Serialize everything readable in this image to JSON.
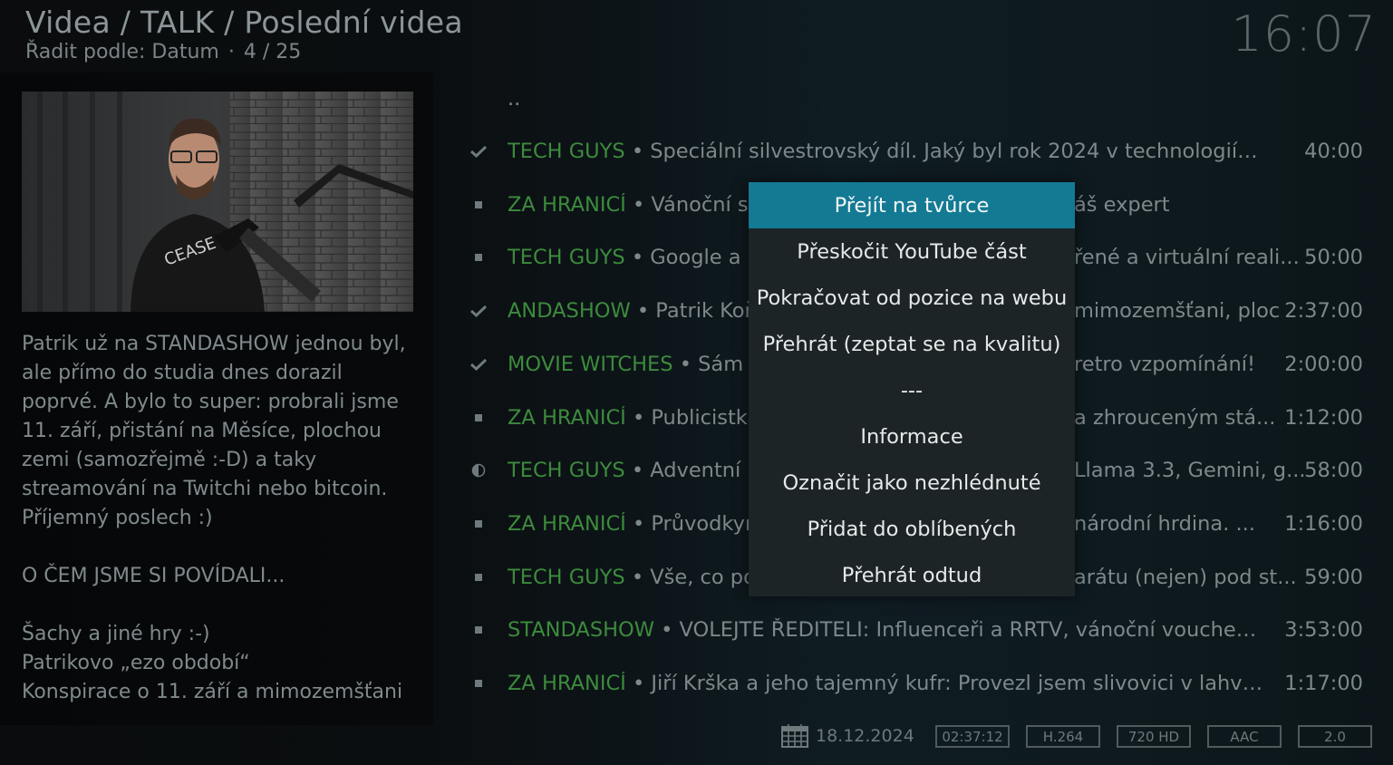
{
  "header": {
    "title": "Videa / TALK / Poslední videa",
    "sort_label": "Řadit podle: Datum",
    "position": "4 / 25"
  },
  "clock": "16:07",
  "description": "Patrik už na STANDASHOW jednou byl, ale přímo do studia dnes dorazil poprvé. A bylo to super: probrali jsme 11. září, přistání na Měsíce, plochou zemi (samozřejmě :-D) a taky streamování na Twitchi nebo bitcoin. Příjemný poslech :)\n\nO ČEM JSME SI POVÍDALI...\n\nŠachy a jiné hry :-)\nPatrikovo „ezo období“\nKonspirace o 11. září a mimozemšťani",
  "list": {
    "parent": "..",
    "items": [
      {
        "status": "watched",
        "channel": "TECH GUYS",
        "title": " • Speciální silvestrovský díl. Jaký byl rok 2024 v technologiích a c...",
        "duration": "40:00"
      },
      {
        "status": "unwatched",
        "channel": "ZA HRANICÍ",
        "title": " • Vánoční sp",
        "tail": "áš expert",
        "duration": ""
      },
      {
        "status": "unwatched",
        "channel": "TECH GUYS",
        "title": " • Google a S",
        "tail": "řené a virtuální reali...",
        "duration": "50:00"
      },
      {
        "status": "watched",
        "channel": "ANDASHOW",
        "title": " • Patrik Koř",
        "tail": "mimozemšťani, ploc",
        "duration": "2:37:00"
      },
      {
        "status": "watched",
        "channel": "MOVIE WITCHES",
        "title": " • Sám d",
        "tail": "retro vzpomínání!",
        "duration": "2:00:00"
      },
      {
        "status": "unwatched",
        "channel": "ZA HRANICÍ",
        "title": " • Publicistka",
        "tail": "a zhrouceným stá...",
        "duration": "1:12:00"
      },
      {
        "status": "partial",
        "channel": "TECH GUYS",
        "title": " • Adventní k",
        "tail": "Llama 3.3, Gemini, g...",
        "duration": "58:00"
      },
      {
        "status": "unwatched",
        "channel": "ZA HRANICÍ",
        "title": " • Průvodkyn",
        "tail": "národní hrdina. ...",
        "duration": "1:16:00"
      },
      {
        "status": "unwatched",
        "channel": "TECH GUYS",
        "title": " • Vše, co pot",
        "tail": "arátu (nejen) pod st...",
        "duration": "59:00"
      },
      {
        "status": "unwatched",
        "channel": "STANDASHOW",
        "title": " • VOLEJTE ŘEDITELI: Influenceři a RRTV, vánoční vouchery, s...",
        "duration": "3:53:00"
      },
      {
        "status": "unwatched",
        "channel": "ZA HRANICÍ",
        "title": " • Jiří Krška a jeho tajemný kufr: Provezl jsem slivovici v lahvích ...",
        "duration": "1:17:00"
      }
    ]
  },
  "context_menu": {
    "items": [
      "Přejít na tvůrce",
      "Přeskočit YouTube část",
      "Pokračovat od pozice na webu",
      "Přehrát (zeptat se na kvalitu)",
      "---",
      "Informace",
      "Označit jako nezhlédnuté",
      "Přidat do oblíbených",
      "Přehrát odtud"
    ],
    "selected_index": 0
  },
  "footer": {
    "date": "18.12.2024",
    "badges": [
      "02:37:12",
      "H.264",
      "720 HD",
      "AAC",
      "2.0"
    ]
  },
  "colors": {
    "accent": "#147a94",
    "channel_green": "#3d8b3d",
    "menu_bg": "#1c2426"
  }
}
